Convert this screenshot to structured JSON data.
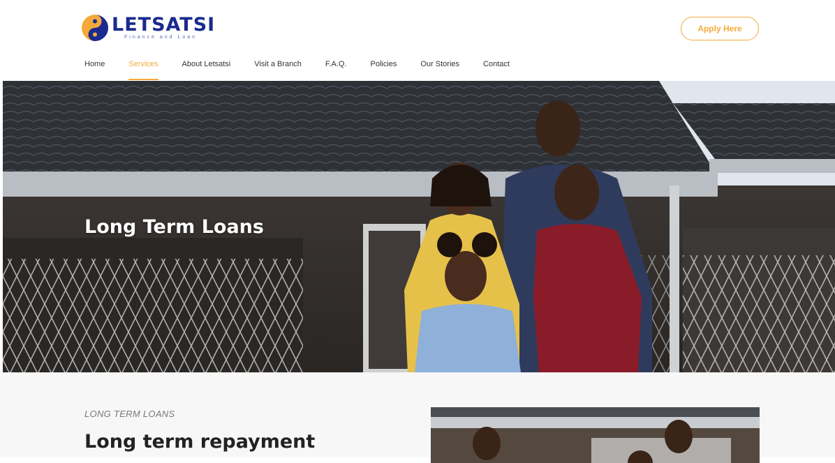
{
  "brand": {
    "name": "LETSATSI",
    "tagline": "Finance and Loan",
    "colors": {
      "navy": "#1b2a8f",
      "orange": "#f4a93a"
    }
  },
  "header": {
    "apply_label": "Apply Here"
  },
  "nav": {
    "items": [
      {
        "label": "Home"
      },
      {
        "label": "Services",
        "active": true
      },
      {
        "label": "About Letsatsi"
      },
      {
        "label": "Visit a Branch"
      },
      {
        "label": "F.A.Q."
      },
      {
        "label": "Policies"
      },
      {
        "label": "Our Stories"
      },
      {
        "label": "Contact"
      }
    ]
  },
  "hero": {
    "title": "Long Term Loans"
  },
  "section": {
    "eyebrow": "LONG TERM LOANS",
    "title": "Long term repayment"
  }
}
